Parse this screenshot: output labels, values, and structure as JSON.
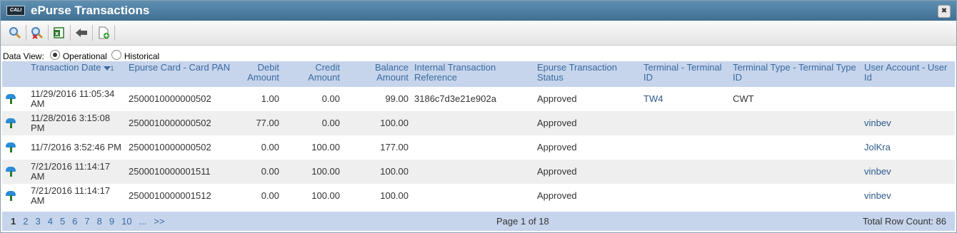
{
  "header": {
    "logo": "CALI",
    "title": "ePurse Transactions"
  },
  "toolbar": {
    "icons": [
      "search-icon",
      "clear-filter-icon",
      "export-excel-icon",
      "back-icon",
      "new-document-icon"
    ]
  },
  "data_view": {
    "label": "Data View:",
    "options": [
      "Operational",
      "Historical"
    ],
    "selected": "Operational"
  },
  "table": {
    "sort_number": "1",
    "columns": [
      "Transaction Date",
      "Epurse Card - Card PAN",
      "Debit Amount",
      "Credit Amount",
      "Balance Amount",
      "Internal Transaction Reference",
      "Epurse Transaction Status",
      "Terminal - Terminal ID",
      "Terminal Type - Terminal Type ID",
      "User Account - User Id"
    ],
    "rows": [
      [
        "11/29/2016 11:05:34 AM",
        "2500010000000502",
        "1.00",
        "0.00",
        "99.00",
        "3186c7d3e21e902a",
        "Approved",
        "TW4",
        "CWT",
        ""
      ],
      [
        "11/28/2016 3:15:08 PM",
        "2500010000000502",
        "77.00",
        "0.00",
        "100.00",
        "",
        "Approved",
        "",
        "",
        "vinbev"
      ],
      [
        "11/7/2016 3:52:46 PM",
        "2500010000000502",
        "0.00",
        "100.00",
        "177.00",
        "",
        "Approved",
        "",
        "",
        "JolKra"
      ],
      [
        "7/21/2016 11:14:17 AM",
        "2500010000001511",
        "0.00",
        "100.00",
        "100.00",
        "",
        "Approved",
        "",
        "",
        "vinbev"
      ],
      [
        "7/21/2016 11:14:17 AM",
        "2500010000001512",
        "0.00",
        "100.00",
        "100.00",
        "",
        "Approved",
        "",
        "",
        "vinbev"
      ]
    ]
  },
  "pager": {
    "pages": [
      "1",
      "2",
      "3",
      "4",
      "5",
      "6",
      "7",
      "8",
      "9",
      "10",
      "...",
      ">>"
    ],
    "current": "1",
    "page_info": "Page 1 of 18",
    "row_count": "Total Row Count: 86"
  }
}
